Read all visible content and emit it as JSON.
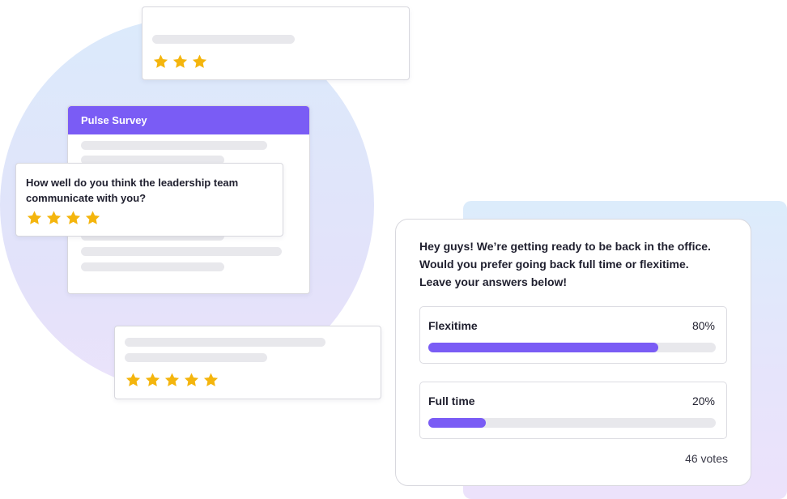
{
  "colors": {
    "accent": "#7a5cf5",
    "star": "#f4b50d",
    "placeholder": "#e8e8ec"
  },
  "top_rating_card": {
    "stars": 3
  },
  "pulse_survey": {
    "title": "Pulse Survey"
  },
  "question_card": {
    "question": "How well do you think the leadership team communicate with you?",
    "stars": 4
  },
  "bottom_rating_card": {
    "stars": 5
  },
  "poll": {
    "question": "Hey guys! We’re getting ready to be back in the office. Would you prefer going back full time or flexitime. Leave your answers below!",
    "options": [
      {
        "label": "Flexitime",
        "percent_label": "80%",
        "percent": 80
      },
      {
        "label": "Full time",
        "percent_label": "20%",
        "percent": 20
      }
    ],
    "votes": "46 votes"
  }
}
